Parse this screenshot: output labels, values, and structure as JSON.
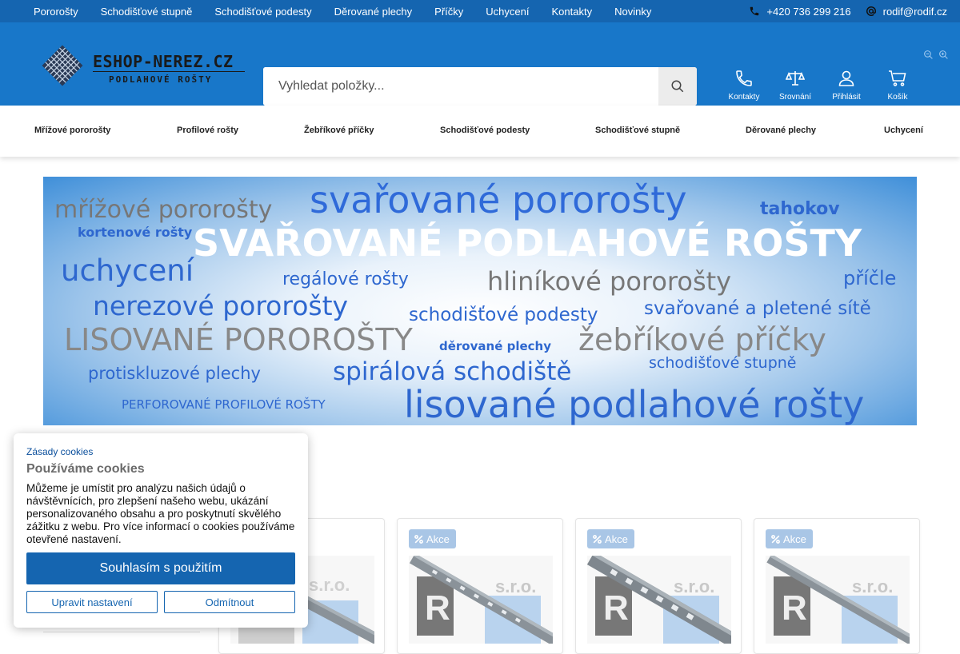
{
  "topbar": {
    "nav": [
      "Pororošty",
      "Schodišťové stupně",
      "Schodišťové podesty",
      "Děrované plechy",
      "Příčky",
      "Uchycení",
      "Kontakty",
      "Novinky"
    ],
    "phone": "+420 736 299 216",
    "email": "rodif@rodif.cz"
  },
  "header": {
    "logo_title": "ESHOP-NEREZ.CZ",
    "logo_subtitle": "PODLAHOVÉ ROŠTY",
    "search_placeholder": "Vyhledat položky...",
    "icons": [
      {
        "label": "Kontakty",
        "icon": "phone-icon"
      },
      {
        "label": "Srovnání",
        "icon": "scales-icon"
      },
      {
        "label": "Přihlásit",
        "icon": "user-icon"
      },
      {
        "label": "Košík",
        "icon": "cart-icon"
      }
    ]
  },
  "categories": [
    "Mřížové pororošty",
    "Profilové rošty",
    "Žebříkové příčky",
    "Schodišťové podesty",
    "Schodišťové stupně",
    "Děrované plechy",
    "Uchycení"
  ],
  "banner": {
    "words": [
      "svařované pororošty",
      "mřížové pororošty",
      "tahokov",
      "kortenové rošty",
      "SVAŘOVANÉ PODLAHOVÉ ROŠTY",
      "uchycení",
      "regálové rošty",
      "hliníkové pororošty",
      "příčle",
      "nerezové pororošty",
      "schodišťové podesty",
      "svařované a pletené sítě",
      "LISOVANÉ POROROŠTY",
      "děrované plechy",
      "žebříkové příčky",
      "schodišťové stupně",
      "protiskluzové plechy",
      "spirálová schodiště",
      "PERFOROVANÉ PROFILOVÉ ROŠTY",
      "lisované podlahové rošty"
    ]
  },
  "products": {
    "badge": "Akce",
    "logo_text": "s.r.o."
  },
  "cookie": {
    "policy_link": "Zásady cookies",
    "title": "Používáme cookies",
    "body": "Můžeme je umístit pro analýzu našich údajů o návštěvnících, pro zlepšení našeho webu, ukázání personalizovaného obsahu a pro poskytnutí skvělého zážitku z webu. Pro více informací o cookies používáme otevřené nastavení.",
    "accept": "Souhlasím s použitím",
    "settings": "Upravit nastavení",
    "decline": "Odmítnout"
  },
  "colors": {
    "topbar": "#1565b0",
    "header": "#1877c9",
    "accent": "#1565b0",
    "badge": "#a9c6e6"
  }
}
